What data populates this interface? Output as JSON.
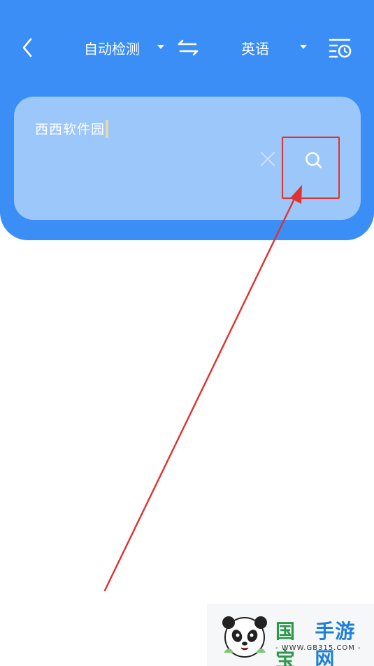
{
  "topbar": {
    "source_language": "自动检测",
    "target_language": "英语"
  },
  "input": {
    "text": "西西软件园"
  },
  "watermark": {
    "brand_part1": "国宝",
    "brand_part2": "手游网",
    "url": "- WWW.GB315.COM -"
  },
  "icons": {
    "back": "chevron-left-icon",
    "swap": "swap-arrows-icon",
    "history": "history-list-clock-icon",
    "clear": "close-icon",
    "search": "search-icon"
  },
  "colors": {
    "header_blue": "#3a8ef6",
    "input_card": "#9cc7fb",
    "annotation_red": "#e0312e"
  }
}
